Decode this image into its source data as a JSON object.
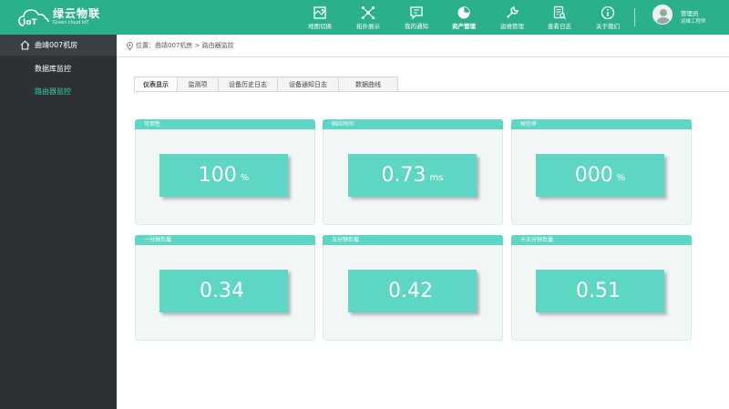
{
  "app": {
    "logo_title": "绿云物联",
    "logo_sub": "Green cloud IoT",
    "logo_mark_text": "IoT"
  },
  "colors": {
    "header": "#2bb08c",
    "sidebar": "#2e3236",
    "accent": "#5dd6c3",
    "active_link": "#35c9a3"
  },
  "nav": [
    {
      "label": "地图切换",
      "icon": "map-icon"
    },
    {
      "label": "拓扑展示",
      "icon": "topology-icon"
    },
    {
      "label": "我的通知",
      "icon": "message-icon"
    },
    {
      "label": "资产管理",
      "icon": "pie-chart-icon",
      "active": true
    },
    {
      "label": "运维管理",
      "icon": "wrench-icon"
    },
    {
      "label": "查看日志",
      "icon": "log-icon"
    },
    {
      "label": "关于我们",
      "icon": "info-icon"
    }
  ],
  "user": {
    "name": "管理员",
    "role": "运维工程师"
  },
  "sidebar": {
    "top_label": "曲靖007机房",
    "items": [
      {
        "label": "数据库监控",
        "active": false
      },
      {
        "label": "路由器监控",
        "active": true
      }
    ]
  },
  "breadcrumb": {
    "text": "位置：曲靖007机房 > 路由器监控"
  },
  "tabs": [
    {
      "label": "仪表显示",
      "active": true
    },
    {
      "label": "监测项",
      "active": false
    },
    {
      "label": "设备历史日志",
      "active": false
    },
    {
      "label": "设备通知日志",
      "active": false
    },
    {
      "label": "数据曲线",
      "active": false
    }
  ],
  "cards": [
    {
      "title": "可用性",
      "value": "100",
      "unit": "%"
    },
    {
      "title": "响应时间",
      "value": "0.73",
      "unit": "ms"
    },
    {
      "title": "掉包率",
      "value": "000",
      "unit": "%"
    },
    {
      "title": "一分钟负载",
      "value": "0.34",
      "unit": ""
    },
    {
      "title": "五分钟负载",
      "value": "0.42",
      "unit": ""
    },
    {
      "title": "十五分钟负载",
      "value": "0.51",
      "unit": ""
    }
  ]
}
